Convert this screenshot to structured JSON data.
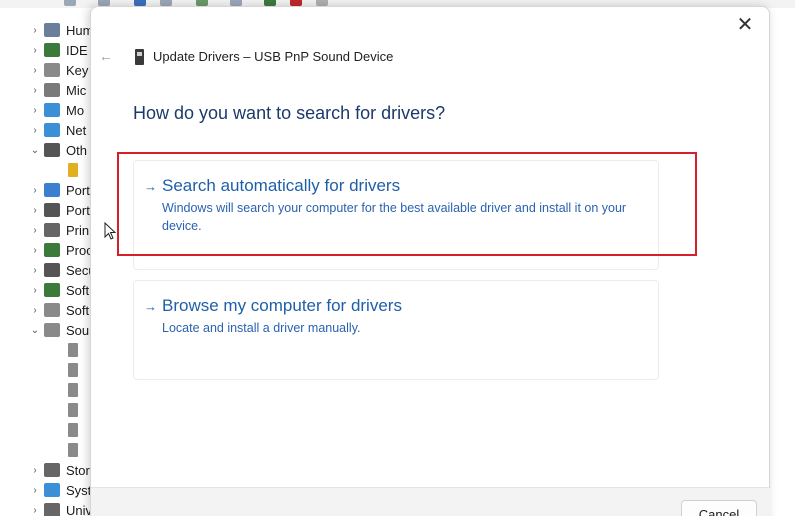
{
  "background": {
    "tree_items": [
      {
        "label": "Hum",
        "chevron": "›",
        "color": "#6b7f9a"
      },
      {
        "label": "IDE",
        "chevron": "›",
        "color": "#3c7a3c"
      },
      {
        "label": "Key",
        "chevron": "›",
        "color": "#8a8a8a"
      },
      {
        "label": "Mic",
        "chevron": "›",
        "color": "#7a7a7a"
      },
      {
        "label": "Mo",
        "chevron": "›",
        "color": "#3b8fd6"
      },
      {
        "label": "Net",
        "chevron": "›",
        "color": "#3b8fd6"
      },
      {
        "label": "Oth",
        "chevron": "⌄",
        "color": "#555555"
      },
      {
        "label": "",
        "chevron": "",
        "color": "#e0b020",
        "sub": true
      },
      {
        "label": "Port",
        "chevron": "›",
        "color": "#3b7fd0"
      },
      {
        "label": "Port",
        "chevron": "›",
        "color": "#555555"
      },
      {
        "label": "Prin",
        "chevron": "›",
        "color": "#666666"
      },
      {
        "label": "Proc",
        "chevron": "›",
        "color": "#3c7a3c"
      },
      {
        "label": "Secu",
        "chevron": "›",
        "color": "#555555"
      },
      {
        "label": "Soft",
        "chevron": "›",
        "color": "#3c7a3c"
      },
      {
        "label": "Soft",
        "chevron": "›",
        "color": "#8a8a8a"
      },
      {
        "label": "Sou",
        "chevron": "⌄",
        "color": "#8a8a8a"
      },
      {
        "label": "",
        "chevron": "",
        "color": "#8a8a8a",
        "sub": true
      },
      {
        "label": "",
        "chevron": "",
        "color": "#8a8a8a",
        "sub": true
      },
      {
        "label": "",
        "chevron": "",
        "color": "#8a8a8a",
        "sub": true
      },
      {
        "label": "",
        "chevron": "",
        "color": "#8a8a8a",
        "sub": true
      },
      {
        "label": "",
        "chevron": "",
        "color": "#8a8a8a",
        "sub": true
      },
      {
        "label": "",
        "chevron": "",
        "color": "#8a8a8a",
        "sub": true
      },
      {
        "label": "Stor",
        "chevron": "›",
        "color": "#666666"
      },
      {
        "label": "Syst",
        "chevron": "›",
        "color": "#3b8fd6"
      },
      {
        "label": "Univ",
        "chevron": "›",
        "color": "#666666"
      }
    ]
  },
  "dialog": {
    "close_glyph": "✕",
    "back_glyph": "←",
    "title": "Update Drivers – USB PnP Sound Device",
    "heading": "How do you want to search for drivers?",
    "options": [
      {
        "arrow": "→",
        "title": "Search automatically for drivers",
        "description": "Windows will search your computer for the best available driver and install it on your device."
      },
      {
        "arrow": "→",
        "title": "Browse my computer for drivers",
        "description": "Locate and install a driver manually."
      }
    ],
    "cancel_label": "Cancel"
  },
  "colors": {
    "accent_link": "#1f5fa8",
    "heading": "#1b3a6b",
    "highlight": "#d32029"
  }
}
